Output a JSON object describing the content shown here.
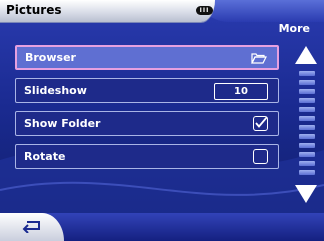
{
  "header": {
    "title": "Pictures",
    "battery": "III",
    "more_label": "More"
  },
  "menu": {
    "items": [
      {
        "label": "Browser",
        "control": "folder-icon",
        "selected": true
      },
      {
        "label": "Slideshow",
        "control": "value",
        "value": "10"
      },
      {
        "label": "Show Folder",
        "control": "checkbox",
        "checked": true
      },
      {
        "label": "Rotate",
        "control": "checkbox",
        "checked": false
      }
    ]
  },
  "icons": {
    "scroll_up": "up-arrow-icon",
    "scroll_down": "down-arrow-icon",
    "back": "back-arrow-icon",
    "folder": "folder-open-icon"
  },
  "colors": {
    "background": "#1a2a90",
    "selected_item": "#5f6fd2",
    "selected_border": "#e6a0e0",
    "header": "#ffffff"
  }
}
